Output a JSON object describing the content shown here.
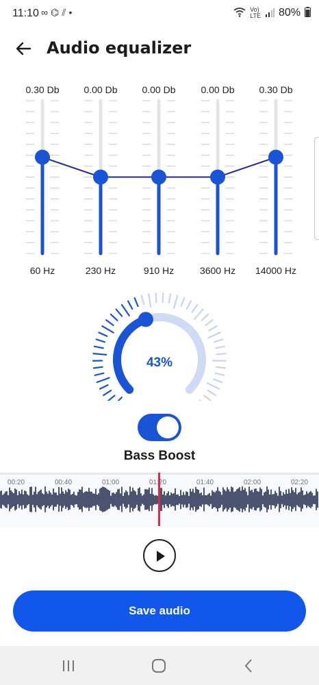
{
  "status_bar": {
    "time": "11:10",
    "battery": "80%"
  },
  "header": {
    "title": "Audio equalizer"
  },
  "equalizer": {
    "bands": [
      {
        "value_label": "0.30 Db",
        "freq_label": "60 Hz",
        "level": 0.63
      },
      {
        "value_label": "0.00 Db",
        "freq_label": "230 Hz",
        "level": 0.5
      },
      {
        "value_label": "0.00 Db",
        "freq_label": "910 Hz",
        "level": 0.5
      },
      {
        "value_label": "0.00 Db",
        "freq_label": "3600 Hz",
        "level": 0.5
      },
      {
        "value_label": "0.30 Db",
        "freq_label": "14000 Hz",
        "level": 0.63
      }
    ],
    "accent_color": "#1953d6"
  },
  "knob": {
    "value_label": "43%",
    "level": 0.43
  },
  "bass_boost": {
    "label": "Bass Boost",
    "enabled": true
  },
  "timeline": {
    "ticks": [
      "00:20",
      "00:40",
      "01:00",
      "01:20",
      "01:40",
      "02:00",
      "02:20"
    ],
    "playhead_color": "#e0294a"
  },
  "player": {
    "play_icon": "play-icon"
  },
  "actions": {
    "save_label": "Save audio"
  },
  "nav": {
    "recent_icon": "recent-apps-icon",
    "home_icon": "home-icon",
    "back_icon": "back-icon"
  }
}
